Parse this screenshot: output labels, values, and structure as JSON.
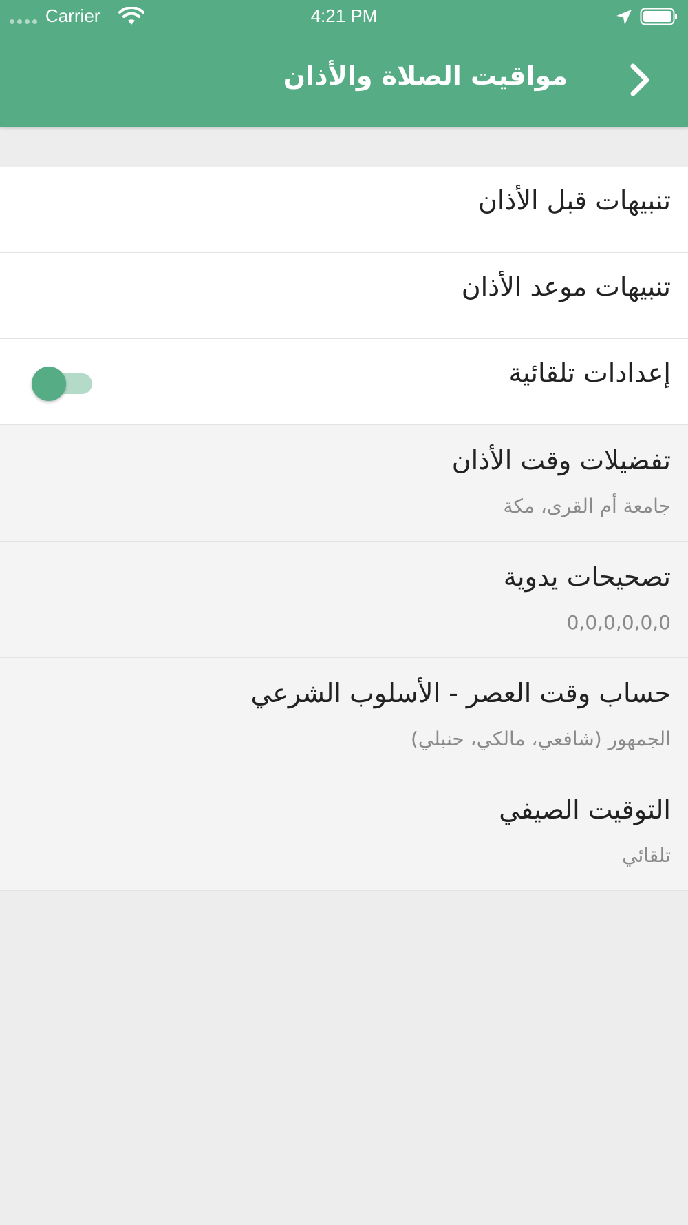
{
  "status_bar": {
    "carrier": "Carrier",
    "time": "4:21 PM",
    "signal_icon": "signal-dots-icon",
    "wifi_icon": "wifi-icon",
    "location_icon": "location-arrow-icon",
    "battery_icon": "battery-icon"
  },
  "header": {
    "title": "مواقيت الصلاة والأذان",
    "back_icon": "chevron-right-icon",
    "color": "#55ac85"
  },
  "settings": {
    "items": [
      {
        "title": "تنبيهات قبل الأذان"
      },
      {
        "title": "تنبيهات موعد الأذان"
      },
      {
        "title": "إعدادات تلقائية",
        "toggle_on": true
      },
      {
        "title": "تفضيلات وقت الأذان",
        "subtitle": "جامعة أم القرى، مكة"
      },
      {
        "title": "تصحيحات يدوية",
        "subtitle": "0,0,0,0,0,0"
      },
      {
        "title": "حساب وقت العصر - الأسلوب الشرعي",
        "subtitle": "الجمهور (شافعي، مالكي، حنبلي)"
      },
      {
        "title": "التوقيت الصيفي",
        "subtitle": "تلقائي"
      }
    ]
  }
}
